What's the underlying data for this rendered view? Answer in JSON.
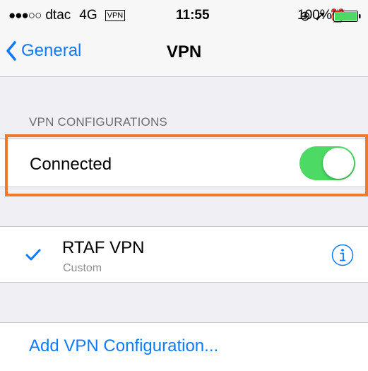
{
  "status_bar": {
    "signal": "●●●○○",
    "carrier": "dtac",
    "network": "4G",
    "vpn_badge": "VPN",
    "time": "11:55",
    "indicators": "⊕ ➚ ⏰",
    "battery": "100%",
    "battery_color": "#4cd964"
  },
  "nav": {
    "back_label": "General",
    "title": "VPN"
  },
  "section": {
    "header": "VPN CONFIGURATIONS"
  },
  "connection": {
    "label": "Connected",
    "toggle_on": true,
    "toggle_color": "#4cd964"
  },
  "vpn_config": {
    "name": "RTAF VPN",
    "type": "Custom",
    "selected": true
  },
  "add_configuration": {
    "label": "Add VPN Configuration..."
  },
  "colors": {
    "accent": "#0d7bfe",
    "highlight": "#ee7a2a",
    "background": "#efeff4"
  },
  "icons": [
    "back-chevron-icon",
    "checkmark-icon",
    "info-icon",
    "battery-icon",
    "lock-rotation-icon",
    "location-icon",
    "alarm-icon"
  ]
}
